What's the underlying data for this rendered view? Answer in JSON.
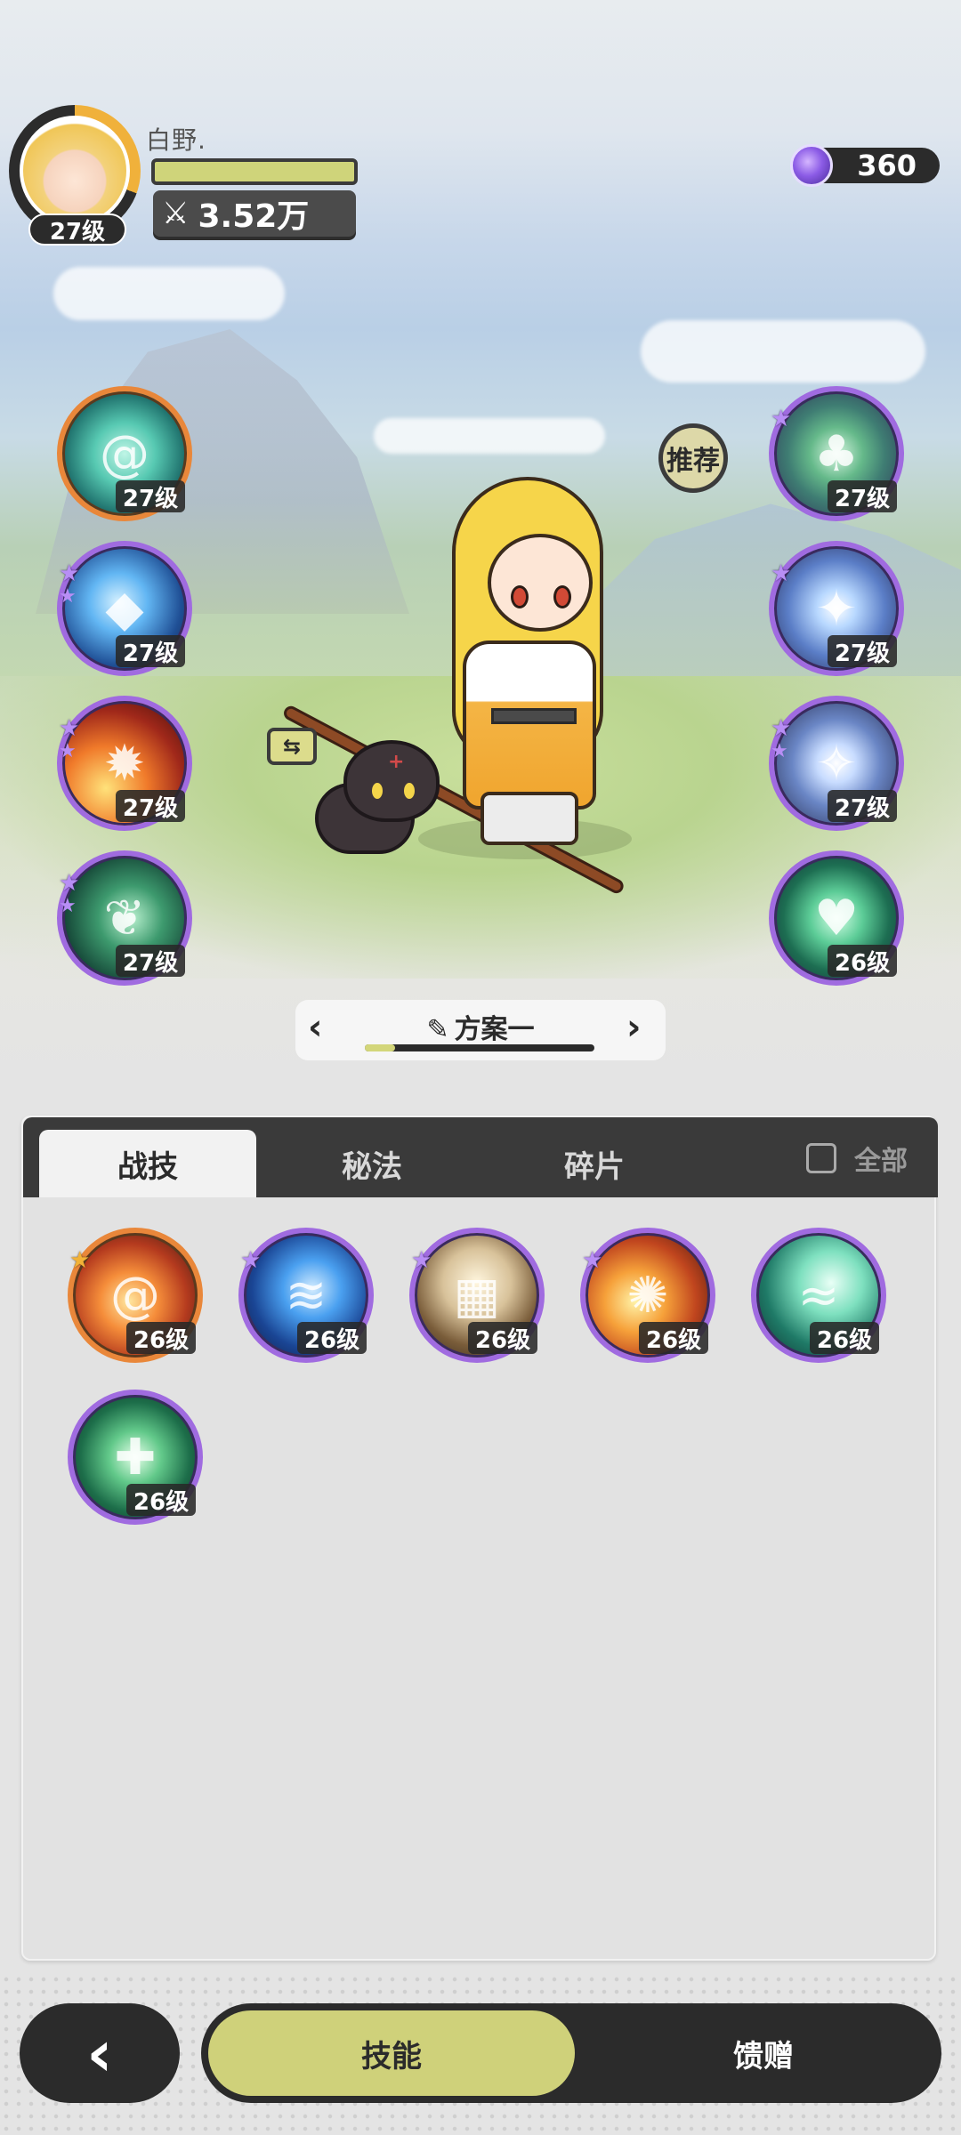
{
  "player": {
    "name": "白野.",
    "avatar_level": "27级",
    "power": "3.52万",
    "power_icon": "crossed-swords-icon"
  },
  "currency": {
    "amount": "360",
    "icon": "purple-orb-currency-icon"
  },
  "equipped_left": [
    {
      "level": "27级",
      "icon": "teal-vortex-icon",
      "rarity": "orange",
      "stars": 0
    },
    {
      "level": "27级",
      "icon": "ice-crystal-icon",
      "rarity": "purple",
      "stars": 2
    },
    {
      "level": "27级",
      "icon": "fireball-icon",
      "rarity": "purple",
      "stars": 2
    },
    {
      "level": "27级",
      "icon": "thorn-vine-icon",
      "rarity": "purple",
      "stars": 2
    }
  ],
  "equipped_right": [
    {
      "level": "27级",
      "icon": "clover-emblem-icon",
      "rarity": "purple",
      "stars": 1
    },
    {
      "level": "27级",
      "icon": "four-point-star-icon",
      "rarity": "purple",
      "stars": 1
    },
    {
      "level": "27级",
      "icon": "gem-shield-icon",
      "rarity": "purple",
      "stars": 2
    },
    {
      "level": "26级",
      "icon": "heart-spade-icon",
      "rarity": "purple",
      "stars": 0
    }
  ],
  "recommend_label": "推荐",
  "swap_label": "⇆",
  "preset": {
    "name": "方案一",
    "progress": 0.13
  },
  "tabs": [
    {
      "label": "战技",
      "active": true
    },
    {
      "label": "秘法",
      "active": false
    },
    {
      "label": "碎片",
      "active": false
    }
  ],
  "show_all_label": "全部",
  "inventory": [
    {
      "level": "26级",
      "icon": "fire-vortex-icon",
      "rarity": "orange",
      "star": "gold"
    },
    {
      "level": "26级",
      "icon": "blue-flame-icon",
      "rarity": "purple",
      "star": "purple"
    },
    {
      "level": "26级",
      "icon": "tarot-cards-icon",
      "rarity": "purple",
      "star": "purple"
    },
    {
      "level": "26级",
      "icon": "explosion-icon",
      "rarity": "purple",
      "star": "purple"
    },
    {
      "level": "26级",
      "icon": "wind-slash-icon",
      "rarity": "purple",
      "star": "none"
    },
    {
      "level": "26级",
      "icon": "heal-cross-icon",
      "rarity": "purple",
      "star": "none"
    }
  ],
  "bottom_nav": {
    "back_icon": "chevron-left-icon",
    "skill_label": "技能",
    "gift_label": "馈赠"
  },
  "colors": {
    "accent_yellow": "#cfd17a",
    "rarity_purple": "#a06be0",
    "rarity_orange": "#e9873a",
    "dark": "#2b2b2b"
  }
}
